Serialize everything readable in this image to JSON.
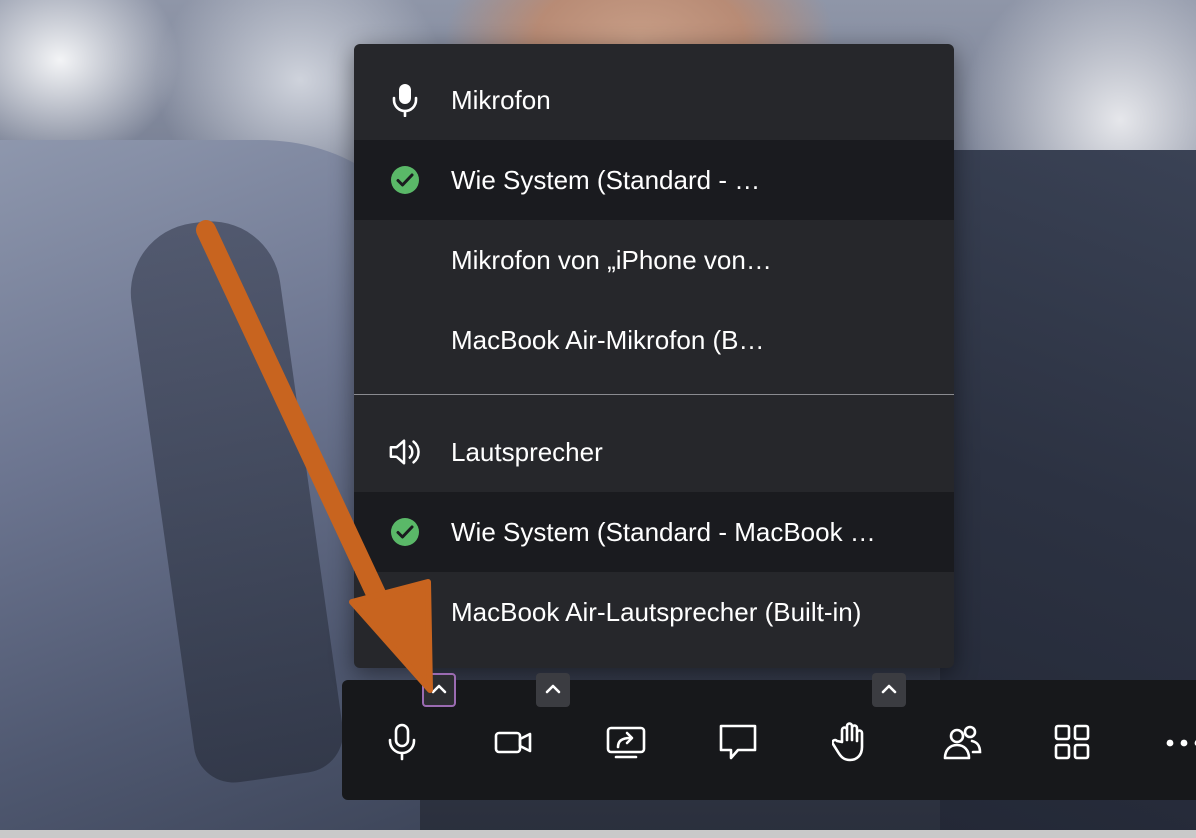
{
  "menu": {
    "microphone": {
      "header_label": "Mikrofon",
      "options": [
        {
          "label": "Wie System (Standard - …",
          "selected": true
        },
        {
          "label": "Mikrofon von „iPhone von…",
          "selected": false
        },
        {
          "label": "MacBook Air-Mikrofon (B…",
          "selected": false
        }
      ]
    },
    "speaker": {
      "header_label": "Lautsprecher",
      "options": [
        {
          "label": "Wie System (Standard - MacBook …",
          "selected": true
        },
        {
          "label": "MacBook Air-Lautsprecher (Built-in)",
          "selected": false
        }
      ]
    }
  },
  "toolbar": {
    "buttons": [
      {
        "icon": "microphone-icon",
        "has_options_caret": true,
        "caret_active": true
      },
      {
        "icon": "camera-icon",
        "has_options_caret": true,
        "caret_active": false
      },
      {
        "icon": "screen-share-icon",
        "has_options_caret": false
      },
      {
        "icon": "chat-icon",
        "has_options_caret": false
      },
      {
        "icon": "raise-hand-icon",
        "has_options_caret": true,
        "caret_active": false
      },
      {
        "icon": "participants-icon",
        "has_options_caret": false
      },
      {
        "icon": "grid-view-icon",
        "has_options_caret": false
      },
      {
        "icon": "more-icon",
        "has_options_caret": false
      }
    ]
  },
  "colors": {
    "menu_bg": "#26272b",
    "menu_selected_bg": "#1a1b1f",
    "check_green": "#5ab868",
    "toolbar_bg": "#17181b",
    "caret_bg": "#3b3c41",
    "caret_active_border": "#9b6bb2",
    "annotation_arrow": "#c8641f"
  }
}
